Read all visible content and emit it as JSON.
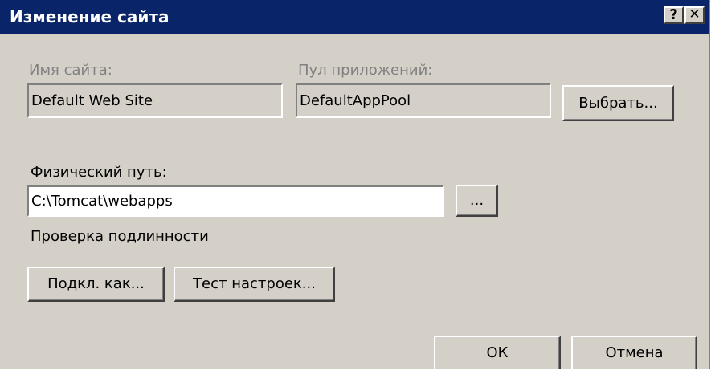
{
  "window": {
    "title": "Изменение сайта",
    "help_button": "?",
    "close_button": "✕"
  },
  "site_name": {
    "label": "Имя сайта:",
    "value": "Default Web Site"
  },
  "app_pool": {
    "label": "Пул приложений:",
    "value": "DefaultAppPool",
    "select_button": "Выбрать..."
  },
  "physical_path": {
    "label": "Физический путь:",
    "value": "C:\\Tomcat\\webapps",
    "browse_button": "..."
  },
  "authentication": {
    "label": "Проверка подлинности",
    "connect_as_button": "Подкл. как...",
    "test_settings_button": "Тест настроек..."
  },
  "footer": {
    "ok_button": "ОК",
    "cancel_button": "Отмена"
  }
}
